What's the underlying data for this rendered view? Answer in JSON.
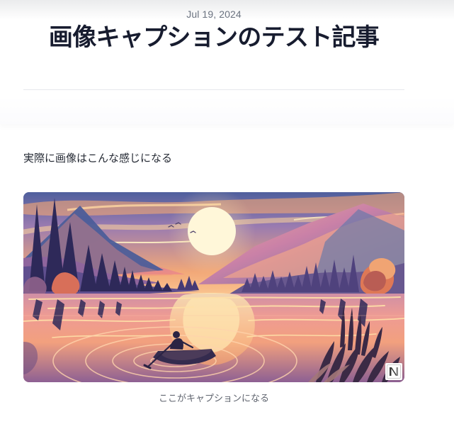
{
  "article": {
    "date": "Jul 19, 2024",
    "title": "画像キャプションのテスト記事",
    "body_text": "実際に画像はこんな感じになる"
  },
  "figure": {
    "caption": "ここがキャプションになる",
    "illustration_icon": "sunset-lake-boat-illustration",
    "badge_icon": "notion-logo-icon"
  },
  "colors": {
    "title": "#171c2f",
    "date": "#6b7380",
    "text": "#262b35",
    "caption": "#60656f",
    "divider": "#e7e8ec"
  }
}
